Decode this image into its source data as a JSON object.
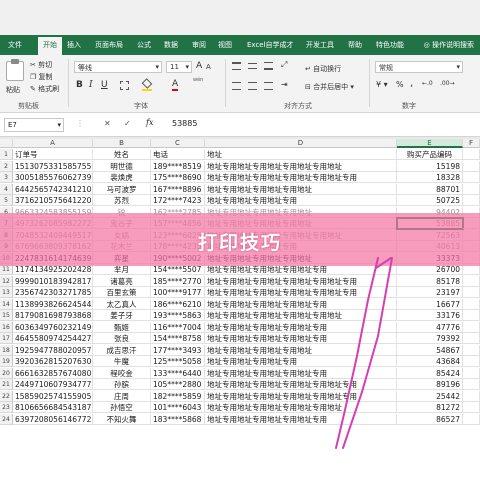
{
  "ribbon_tabs": [
    "文件",
    "开始",
    "插入",
    "页面布局",
    "公式",
    "数据",
    "审阅",
    "视图",
    "Excel自学成才",
    "开发工具",
    "帮助",
    "特色功能"
  ],
  "active_tab_index": 1,
  "help_text": "操作说明搜索",
  "clipboard": {
    "paste": "粘贴",
    "cut": "剪切",
    "copy": "复制",
    "format_painter": "格式刷",
    "group": "剪贴板"
  },
  "font": {
    "name": "等线",
    "size": "11",
    "bold": "B",
    "italic": "I",
    "underline": "U",
    "grow": "A",
    "shrink": "A",
    "color_letter": "A",
    "wen": "wén",
    "group": "字体"
  },
  "alignment": {
    "wrap": "自动换行",
    "merge": "合并后居中",
    "group": "对齐方式"
  },
  "number": {
    "format": "常规",
    "percent": "%",
    "comma": ",",
    "group": "数字"
  },
  "formula_bar": {
    "name_box": "E7",
    "fx": "fx",
    "value": "53885"
  },
  "columns": [
    "A",
    "B",
    "C",
    "D",
    "E",
    "F"
  ],
  "rows": [
    {
      "num": "1",
      "a": "订单号",
      "b": "姓名",
      "c": "电话",
      "d": "地址",
      "e": "购买产品编码",
      "faded": false
    },
    {
      "num": "2",
      "a": "1513075331585755",
      "b": "明世德",
      "c": "189****8519",
      "d": "地址专用地址专用地址专用地址专用地址",
      "e": "15198",
      "faded": false
    },
    {
      "num": "3",
      "a": "3005185576062739",
      "b": "裴焕虎",
      "c": "175****8690",
      "d": "地址专用地址专用地址专用地址专用地址专用",
      "e": "18328",
      "faded": false
    },
    {
      "num": "4",
      "a": "6442565742341210",
      "b": "马可波罗",
      "c": "167****8896",
      "d": "地址专用地址专用地址专用地址",
      "e": "88701",
      "faded": false
    },
    {
      "num": "5",
      "a": "3716210575641220",
      "b": "苏烈",
      "c": "172****7423",
      "d": "地址专用地址专用地址专用",
      "e": "50725",
      "faded": false
    },
    {
      "num": "6",
      "a": "9663324583855159",
      "b": "锐",
      "c": "162****2785",
      "d": "地址专用地址专用地址专用地址",
      "e": "94402",
      "faded": true
    },
    {
      "num": "7",
      "a": "4973262085982272",
      "b": "鬼谷子",
      "c": "157****4856",
      "d": "地址专用地址专用地址专用地址",
      "e": "53885",
      "faded": true
    },
    {
      "num": "8",
      "a": "7048532409449517",
      "b": "女娲",
      "c": "123****6025",
      "d": "地址专用地址专用地址专用地址专用地址",
      "e": "72563",
      "faded": true
    },
    {
      "num": "9",
      "a": "6769663809378162",
      "b": "花木兰",
      "c": "178****4235",
      "d": "地址专用地址专用地址专用",
      "e": "40613",
      "faded": true
    },
    {
      "num": "10",
      "a": "2247831614174639",
      "b": "弈星",
      "c": "190****5002",
      "d": "地址专用地址专用地址专用地址",
      "e": "33373",
      "faded": false
    },
    {
      "num": "11",
      "a": "1174134925202428",
      "b": "芈月",
      "c": "154****5507",
      "d": "地址专用地址专用地址专用地址专用",
      "e": "26700",
      "faded": false
    },
    {
      "num": "12",
      "a": "9999010183942817",
      "b": "诸葛亮",
      "c": "185****2770",
      "d": "地址专用地址专用地址专用地址专用地址专用",
      "e": "85178",
      "faded": false
    },
    {
      "num": "13",
      "a": "2356742303271785",
      "b": "百里玄策",
      "c": "100****9177",
      "d": "地址专用地址专用地址专用地址专用地址专用",
      "e": "23197",
      "faded": false
    },
    {
      "num": "14",
      "a": "1138993826624544",
      "b": "太乙真人",
      "c": "186****6210",
      "d": "地址专用地址专用地址专用地址专用",
      "e": "16677",
      "faded": false
    },
    {
      "num": "15",
      "a": "8179081698793868",
      "b": "姜子牙",
      "c": "193****5863",
      "d": "地址专用地址专用地址专用地址专用地址",
      "e": "33176",
      "faded": false
    },
    {
      "num": "16",
      "a": "6036349760232149",
      "b": "甄姬",
      "c": "116****7004",
      "d": "地址专用地址专用地址专用地址专用",
      "e": "47776",
      "faded": false
    },
    {
      "num": "17",
      "a": "4645580974254427",
      "b": "张良",
      "c": "154****8758",
      "d": "地址专用地址专用地址专用地址专用",
      "e": "79392",
      "faded": false
    },
    {
      "num": "18",
      "a": "1925947788020957",
      "b": "成吉思汗",
      "c": "177****3493",
      "d": "地址专用地址专用地址专用地址",
      "e": "54867",
      "faded": false
    },
    {
      "num": "19",
      "a": "3920362815207630",
      "b": "牛魔",
      "c": "125****5058",
      "d": "地址专用地址专用地址专用",
      "e": "43684",
      "faded": false
    },
    {
      "num": "20",
      "a": "6661632857674080",
      "b": "程咬金",
      "c": "133****6440",
      "d": "地址专用地址专用地址专用地址专用",
      "e": "85424",
      "faded": false
    },
    {
      "num": "21",
      "a": "2449710607934777",
      "b": "孙膑",
      "c": "105****2880",
      "d": "地址专用地址专用地址专用地址专用地址专用",
      "e": "89196",
      "faded": false
    },
    {
      "num": "22",
      "a": "1585902574155905",
      "b": "庄周",
      "c": "182****5859",
      "d": "地址专用地址专用地址专用地址专用地址专用",
      "e": "25442",
      "faded": false
    },
    {
      "num": "23",
      "a": "8106656684543187",
      "b": "孙悟空",
      "c": "101****6043",
      "d": "地址专用地址专用地址专用地址专用地址",
      "e": "81272",
      "faded": false
    },
    {
      "num": "24",
      "a": "6397208056146772",
      "b": "不知火舞",
      "c": "183****5868",
      "d": "地址专用地址专用地址专用地址专用",
      "e": "86527",
      "faded": false
    }
  ],
  "overlay": {
    "title": "打印技巧",
    "banner_color": "#f476a2",
    "stroke_color": "#d63fb0"
  },
  "colors": {
    "excel_green": "#217346"
  }
}
